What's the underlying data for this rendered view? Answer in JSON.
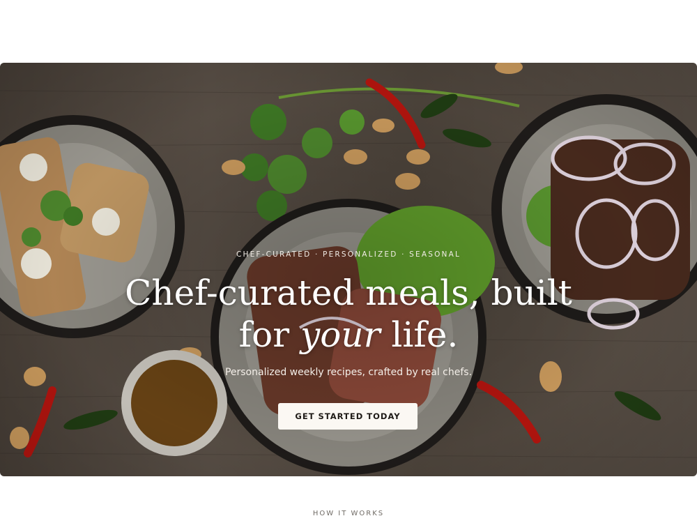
{
  "hero": {
    "eyebrow": "CHEF-CURATED · PERSONALIZED · SEASONAL",
    "headline_line1": "Chef-curated meals, built",
    "headline_for": "for ",
    "headline_italic": "your",
    "headline_end": " life.",
    "subline": "Personalized weekly recipes, crafted by real chefs.",
    "cta_label": "GET STARTED TODAY"
  },
  "next_section": {
    "label": "HOW IT WORKS"
  }
}
